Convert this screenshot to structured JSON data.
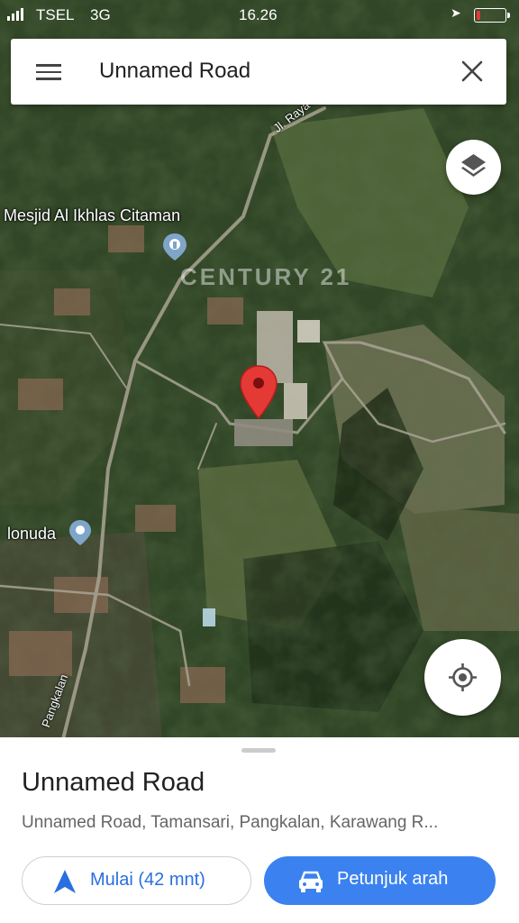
{
  "status_bar": {
    "carrier": "TSEL",
    "network": "3G",
    "time": "16.26",
    "battery_color": "#e53935",
    "battery_level": 0.15
  },
  "search": {
    "title": "Unnamed Road"
  },
  "map": {
    "labels": {
      "poi_mosque": "Mesjid Al Ikhlas Citaman",
      "poi_lonuda": "lonuda",
      "road_top": "Jl. Raya",
      "road_bottom": "Pangkalan"
    },
    "watermark": "CENTURY 21",
    "marker_color": "#e53935"
  },
  "place_sheet": {
    "title": "Unnamed Road",
    "address": "Unnamed Road, Tamansari, Pangkalan, Karawang R...",
    "start_button": "Mulai (42 mnt)",
    "directions_button": "Petunjuk arah",
    "accent_color": "#3b82f0"
  }
}
